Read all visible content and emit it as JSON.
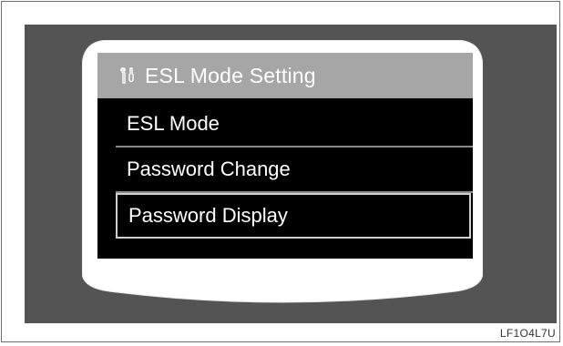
{
  "screen": {
    "title": "ESL Mode Setting",
    "title_icon": "tools-icon",
    "menu_items": [
      {
        "label": "ESL Mode",
        "selected": false
      },
      {
        "label": "Password Change",
        "selected": false
      },
      {
        "label": "Password Display",
        "selected": true
      }
    ]
  },
  "caption": "LF1O4L7U",
  "colors": {
    "panel": "#545454",
    "device": "#ffffff",
    "screen": "#000000",
    "title_bar": "#a6a6a6",
    "text": "#ffffff"
  }
}
